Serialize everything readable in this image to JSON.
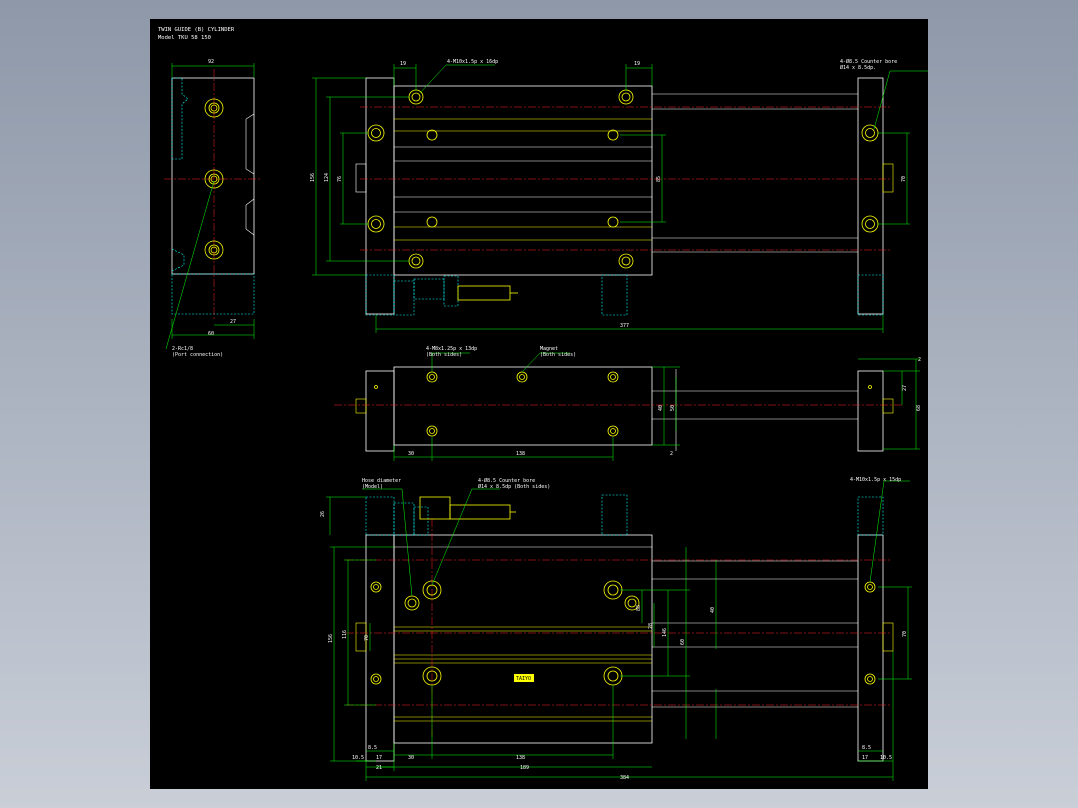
{
  "header": {
    "title": "TWIN GUIDE (B) CYLINDER",
    "model": "Model  TKU 58 150"
  },
  "side_view": {
    "dims": {
      "top_width": "92",
      "bottom_total": "60",
      "bottom_right": "27"
    },
    "port_note_1": "2-Rc1/8",
    "port_note_2": "(Port connection)"
  },
  "top_view": {
    "dims": {
      "left_offset": "19",
      "right_offset": "19",
      "total_height": "156",
      "inner_height": "124",
      "rod_height": "76",
      "center_pitch": "85",
      "right_rod": "70",
      "total_length": "377"
    },
    "notes": {
      "tap_note": "4-M10x1.5p x 16dp",
      "counter_bore_1": "4-Ø8.5 Counter bore",
      "counter_bore_2": "Ø14 x 8.5dp."
    }
  },
  "middle_view": {
    "dims": {
      "left": "30",
      "pitch": "138",
      "right_top": "2",
      "right_a": "27",
      "right_b": "68",
      "inner_a": "40",
      "inner_b": "50",
      "bottom_right": "2"
    },
    "notes": {
      "tap_note_1": "4-M8x1.25p x 13dp",
      "tap_note_2": "(Both sides)",
      "magnet_1": "Magnet",
      "magnet_2": "(Both sides)"
    }
  },
  "bottom_view": {
    "dims": {
      "top_left": "26",
      "total_height": "156",
      "inner_height": "116",
      "center": "70",
      "pitch_a": "88",
      "pitch_b": "28",
      "right_height": "146",
      "right_small": "60",
      "right_lower": "40",
      "left_a": "8.5",
      "left_b": "10.5",
      "left_c": "17",
      "left_d": "21",
      "base_a": "30",
      "base_b": "138",
      "right_a": "8.5",
      "right_b": "17",
      "right_c": "10.5",
      "overall_a": "189",
      "overall_b": "384",
      "right_rod": "70"
    },
    "notes": {
      "hose_1": "Hose diameter",
      "hose_2": "(Model)",
      "cb_1": "4-Ø8.5  Counter bore",
      "cb_2": "Ø14 x 8.5dp (Both sides)",
      "tap_1": "4-M10x1.5p x 15dp",
      "plate": "TAIYO"
    }
  },
  "colors": {
    "background": "#000000",
    "outline": "#ffffff",
    "dimension": "#00ff00",
    "centerline": "#ff2020",
    "hidden": "#00ffff",
    "feature": "#ffff00",
    "accent": "#ff8c00"
  }
}
